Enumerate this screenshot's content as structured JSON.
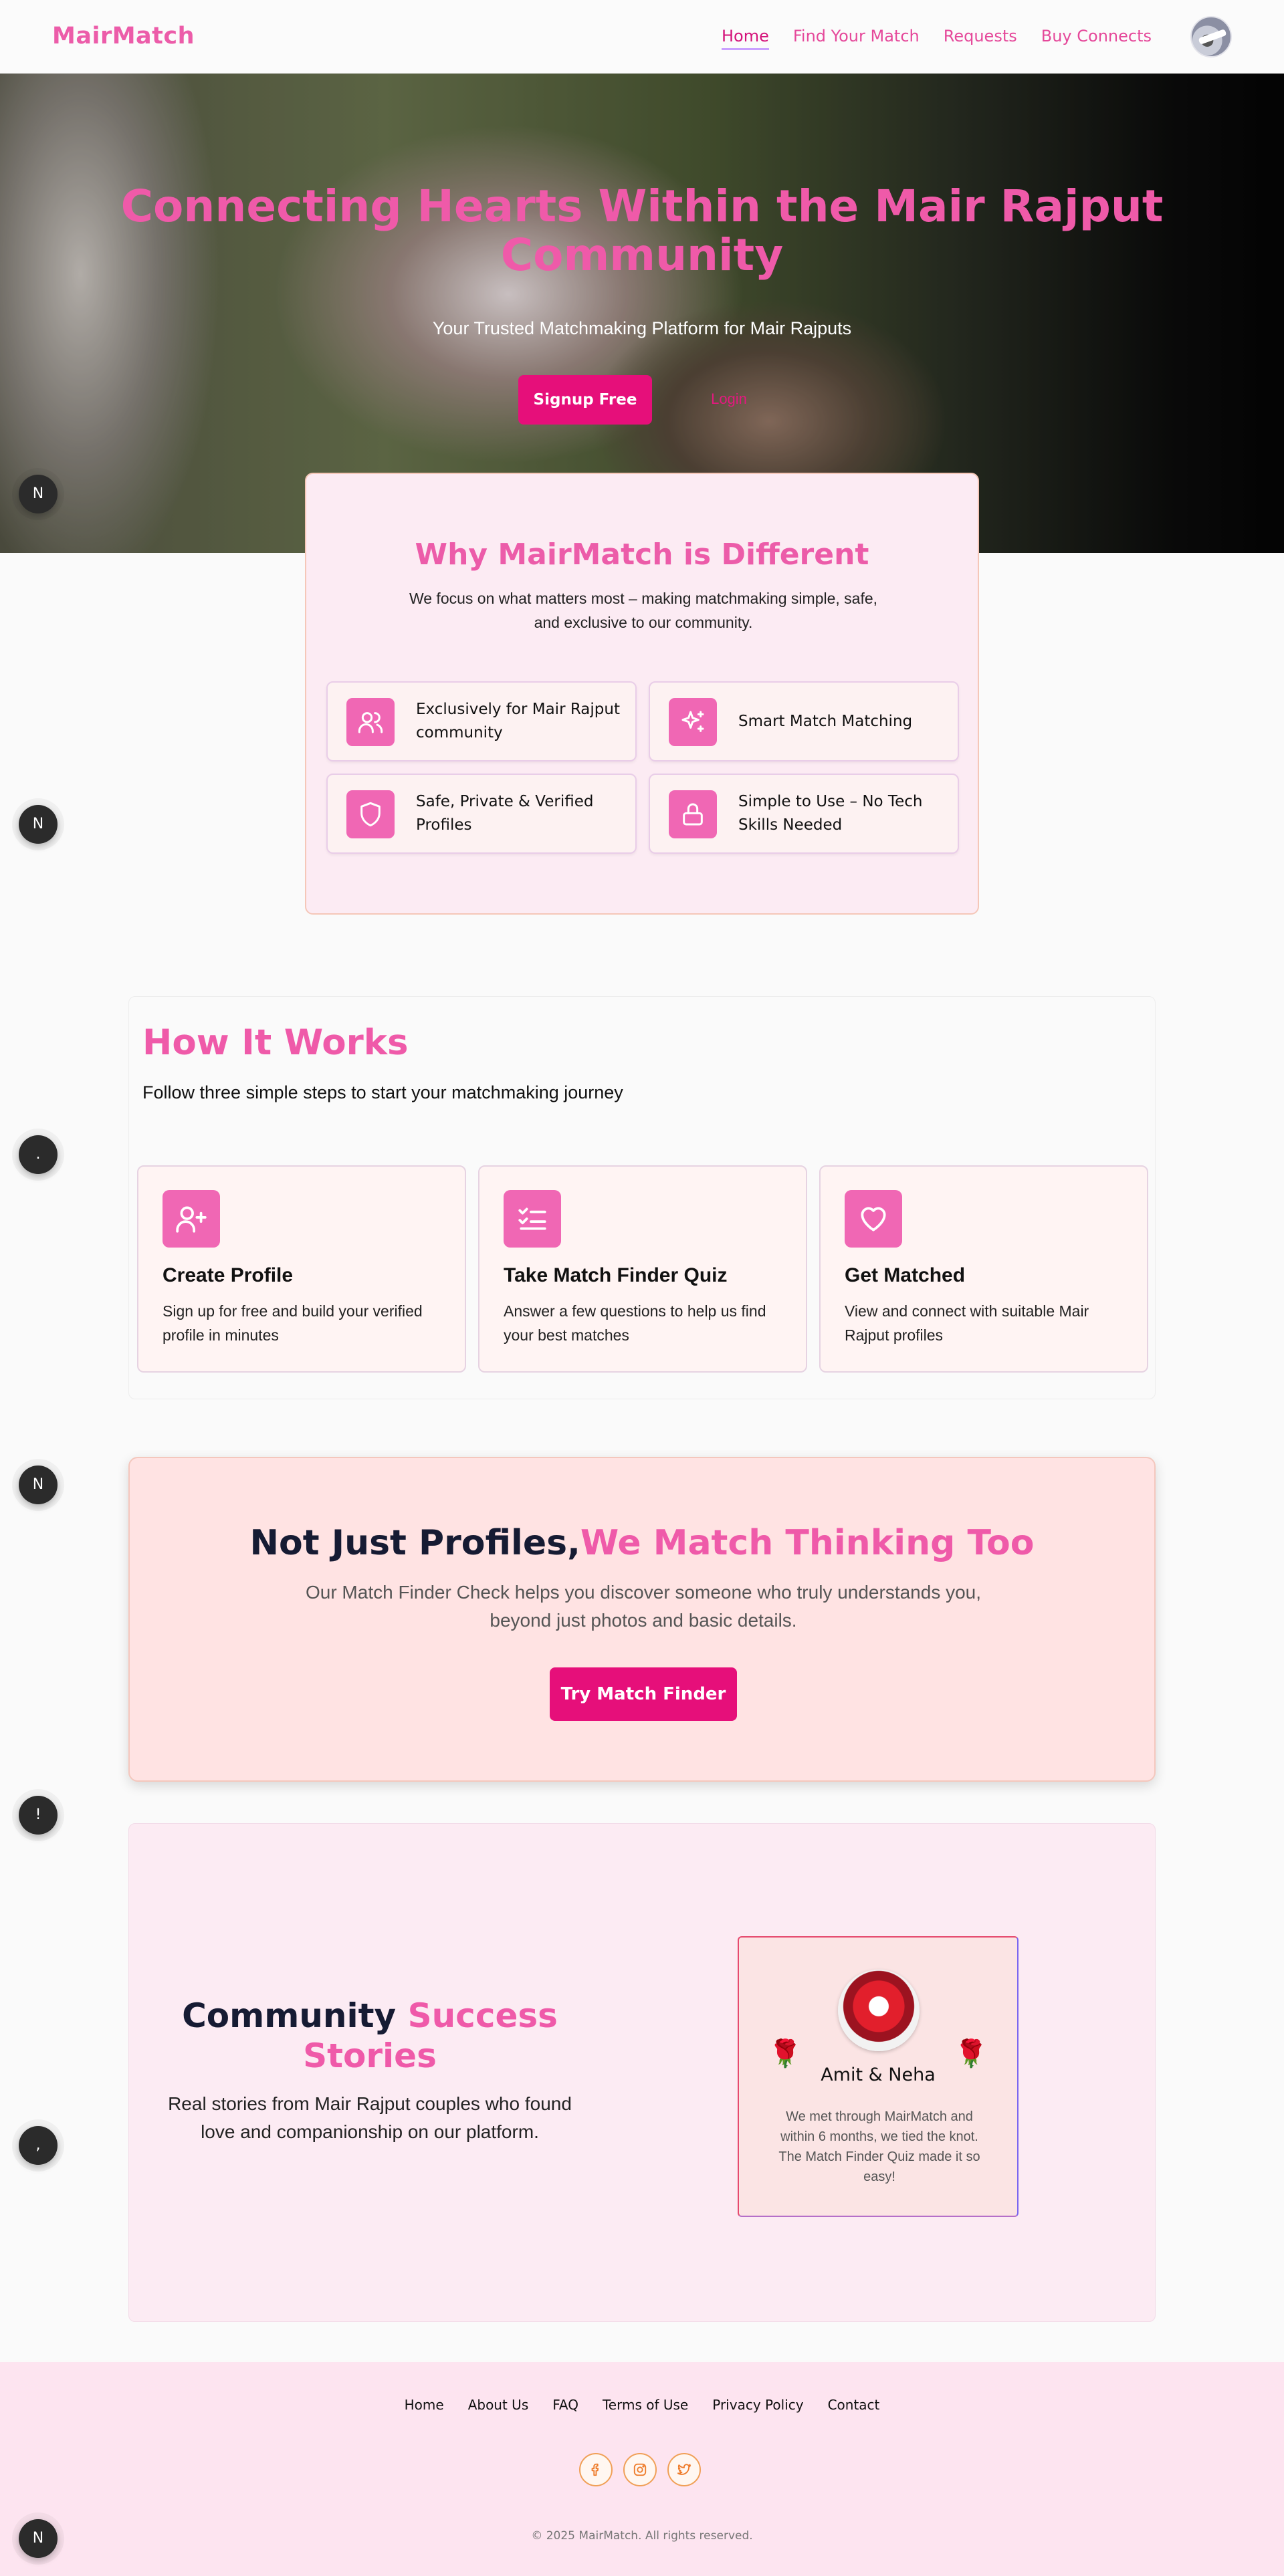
{
  "nav": {
    "brand": "MairMatch",
    "links": [
      "Home",
      "Find Your Match",
      "Requests",
      "Buy Connects"
    ],
    "active": "Home"
  },
  "hero": {
    "title": "Connecting Hearts Within the Mair Rajput Community",
    "tagline": "Your Trusted Matchmaking Platform for Mair Rajputs",
    "signup_label": "Signup Free",
    "login_label": "Login"
  },
  "dev_buttons": [
    "N",
    "N",
    ".",
    "N",
    "!",
    ","
  ],
  "why": {
    "title": "Why MairMatch is Different",
    "description": "We focus on what matters most – making matchmaking simple, safe, and exclusive to our community.",
    "features": [
      {
        "label": "Exclusively for Mair Rajput community",
        "icon": "users-icon"
      },
      {
        "label": "Smart Match Matching",
        "icon": "sparkles-icon"
      },
      {
        "label": "Safe, Private & Verified Profiles",
        "icon": "shield-icon"
      },
      {
        "label": "Simple to Use – No Tech Skills Needed",
        "icon": "lock-icon"
      }
    ]
  },
  "how": {
    "title": "How It Works",
    "subtitle": "Follow three simple steps to start your matchmaking journey",
    "steps": [
      {
        "title": "Create Profile",
        "text": "Sign up for free and build your verified profile in minutes",
        "icon": "user-plus-icon"
      },
      {
        "title": "Take Match Finder Quiz",
        "text": "Answer a few questions to help us find your best matches",
        "icon": "list-checks-icon"
      },
      {
        "title": "Get Matched",
        "text": "View and connect with suitable Mair Rajput profiles",
        "icon": "heart-icon"
      }
    ]
  },
  "cta": {
    "title_dark": "Not Just Profiles,",
    "title_pink": "We Match Thinking Too",
    "text": "Our Match Finder Check helps you discover someone who truly understands you, beyond just photos and basic details.",
    "button": "Try Match Finder"
  },
  "stories": {
    "title_dark": "Community",
    "title_pink": "Success Stories",
    "subtitle": "Real stories from Mair Rajput couples who found love and companionship on our platform.",
    "card": {
      "names": "Amit & Neha",
      "quote": "We met through MairMatch and within 6 months, we tied the knot. The Match Finder Quiz made it so easy!",
      "decoration": "🌹"
    }
  },
  "footer": {
    "links": [
      "Home",
      "About Us",
      "FAQ",
      "Terms of Use",
      "Privacy Policy",
      "Contact"
    ],
    "social": [
      "facebook-icon",
      "instagram-icon",
      "twitter-icon"
    ],
    "copyright": "© 2025 MairMatch. All rights reserved."
  },
  "colors": {
    "accent": "#ec5ca9",
    "button": "#e60f7a",
    "dark_heading": "#161b33",
    "footer_bg": "#fde4f0"
  }
}
